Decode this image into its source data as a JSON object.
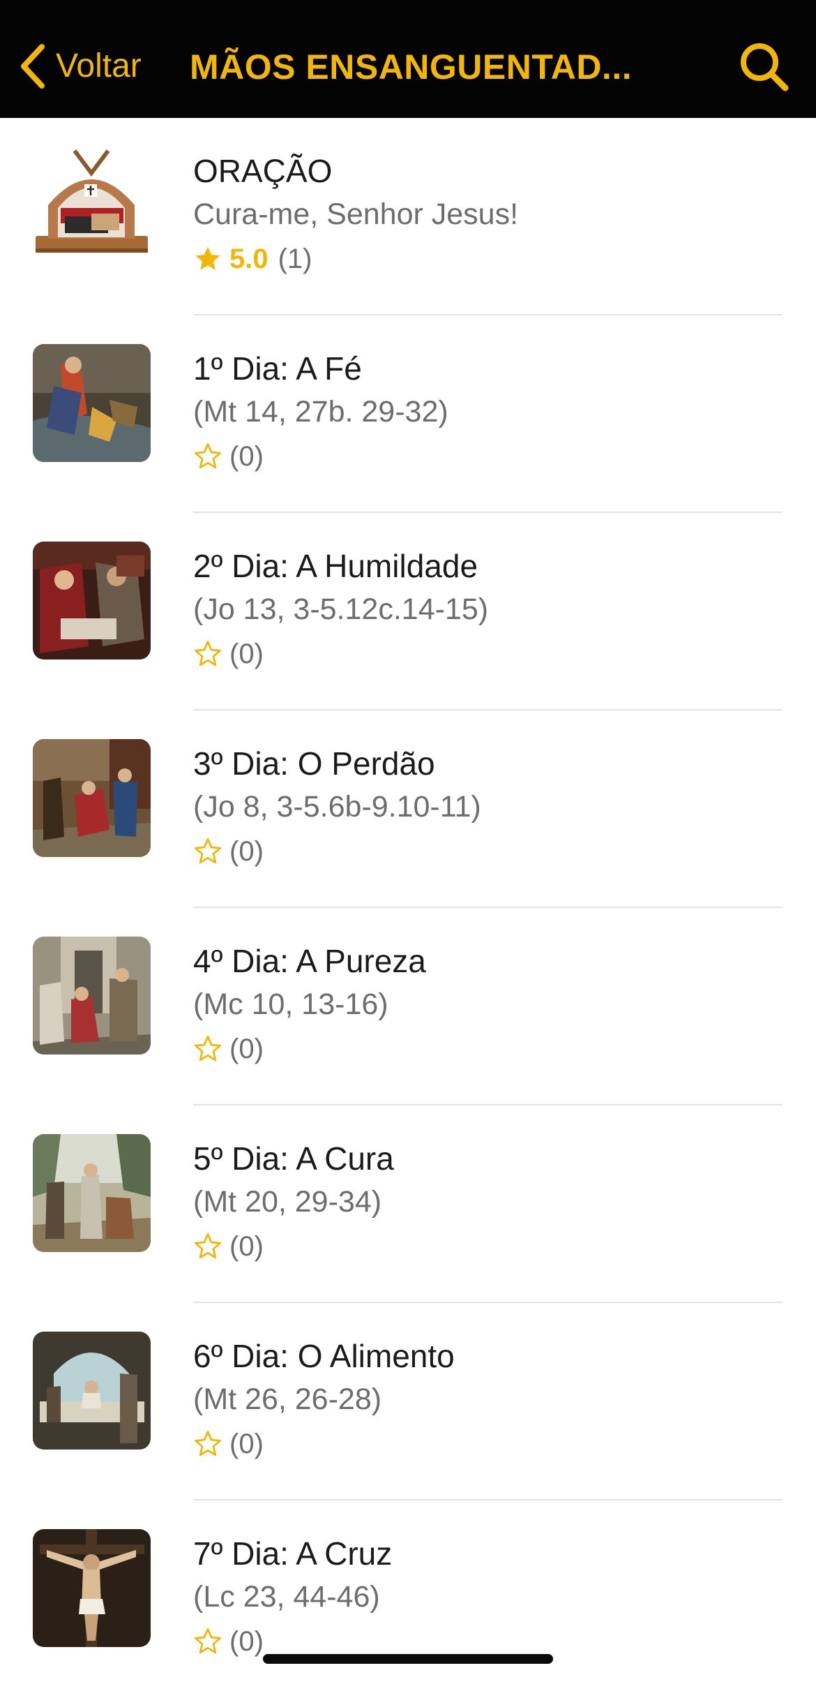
{
  "nav": {
    "back_label": "Voltar",
    "title": "MÃOS ENSANGUENTAD...",
    "accent_color": "#f2b705",
    "background_color": "#030303",
    "back_icon": "chevron-left-icon",
    "search_icon": "search-icon"
  },
  "items": [
    {
      "title": "ORAÇÃO",
      "subtitle": "Cura-me, Senhor Jesus!",
      "rating": 1.0,
      "rating_label": "5.0",
      "count": "(1)"
    },
    {
      "title": "1º Dia: A Fé",
      "subtitle": "(Mt 14, 27b. 29-32)",
      "rating": 0,
      "count": "(0)"
    },
    {
      "title": "2º Dia: A Humildade",
      "subtitle": "(Jo 13, 3-5.12c.14-15)",
      "rating": 0,
      "count": "(0)"
    },
    {
      "title": "3º Dia: O Perdão",
      "subtitle": "(Jo 8, 3-5.6b-9.10-11)",
      "rating": 0,
      "count": "(0)"
    },
    {
      "title": "4º Dia: A Pureza",
      "subtitle": "(Mc 10, 13-16)",
      "rating": 0,
      "count": "(0)"
    },
    {
      "title": "5º Dia: A Cura",
      "subtitle": "(Mt 20, 29-34)",
      "rating": 0,
      "count": "(0)"
    },
    {
      "title": "6º Dia: O Alimento",
      "subtitle": "(Mt 26, 26-28)",
      "rating": 0,
      "count": "(0)"
    },
    {
      "title": "7º Dia: A Cruz",
      "subtitle": "(Lc 23, 44-46)",
      "rating": 0,
      "count": "(0)"
    }
  ]
}
